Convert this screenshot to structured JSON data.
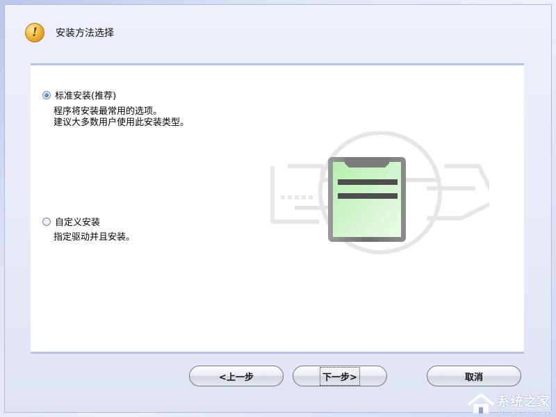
{
  "header": {
    "icon": "warning-icon",
    "icon_glyph": "!",
    "title": "安装方法选择"
  },
  "options": [
    {
      "label": "标准安装(推荐)",
      "selected": true,
      "description": [
        "程序将安装最常用的选项。",
        "建议大多数用户使用此安装类型。"
      ]
    },
    {
      "label": "自定义安装",
      "selected": false,
      "description": [
        "指定驱动并且安装。"
      ]
    }
  ],
  "illustration": {
    "icon": "clipboard-printer-icon",
    "colors": {
      "clipboard_fill": "#c8f3c2",
      "clipboard_border": "#8a8a8a",
      "line": "#4a4a4a"
    }
  },
  "buttons": {
    "back_label": "<上一步",
    "next_label": "下一步>",
    "cancel_label": "取消"
  },
  "watermark": {
    "text": "系统之家",
    "subtext": "XITONGZHIJIA.NET"
  }
}
